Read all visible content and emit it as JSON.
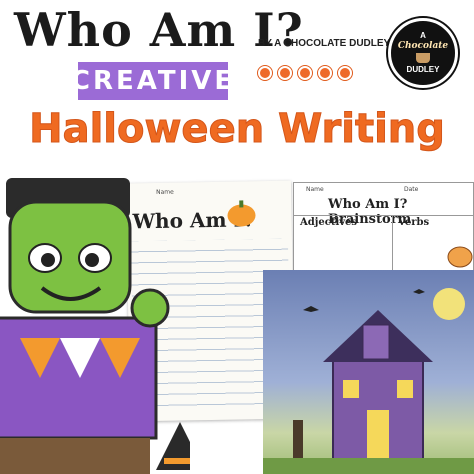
{
  "title": "Who Am I?",
  "byline": "BY A CHOCOLATE DUDLEY",
  "banner": "CREATIVE",
  "subtitle": "Halloween Writing",
  "logo": {
    "line1": "A",
    "line2": "Chocolate",
    "line3": "DUDLEY"
  },
  "paper": {
    "heading": "Who Am I?",
    "name_label": "Name",
    "date_label": "Date"
  },
  "brainstorm": {
    "heading": "Who Am I? Brainstorm",
    "name_label": "Name",
    "date_label": "Date",
    "col1": "Adjectives",
    "col2": "Verbs"
  },
  "colors": {
    "orange": "#ef6a21",
    "purple": "#9b6bd6",
    "frank_green": "#7dc142",
    "sky": "#6b7fb3"
  },
  "icons": [
    "frankenstein-character",
    "pumpkin-icon",
    "haunted-house-drawing",
    "bat-icon",
    "moon-icon",
    "candy-corn-icon",
    "witch-hat-icon"
  ]
}
